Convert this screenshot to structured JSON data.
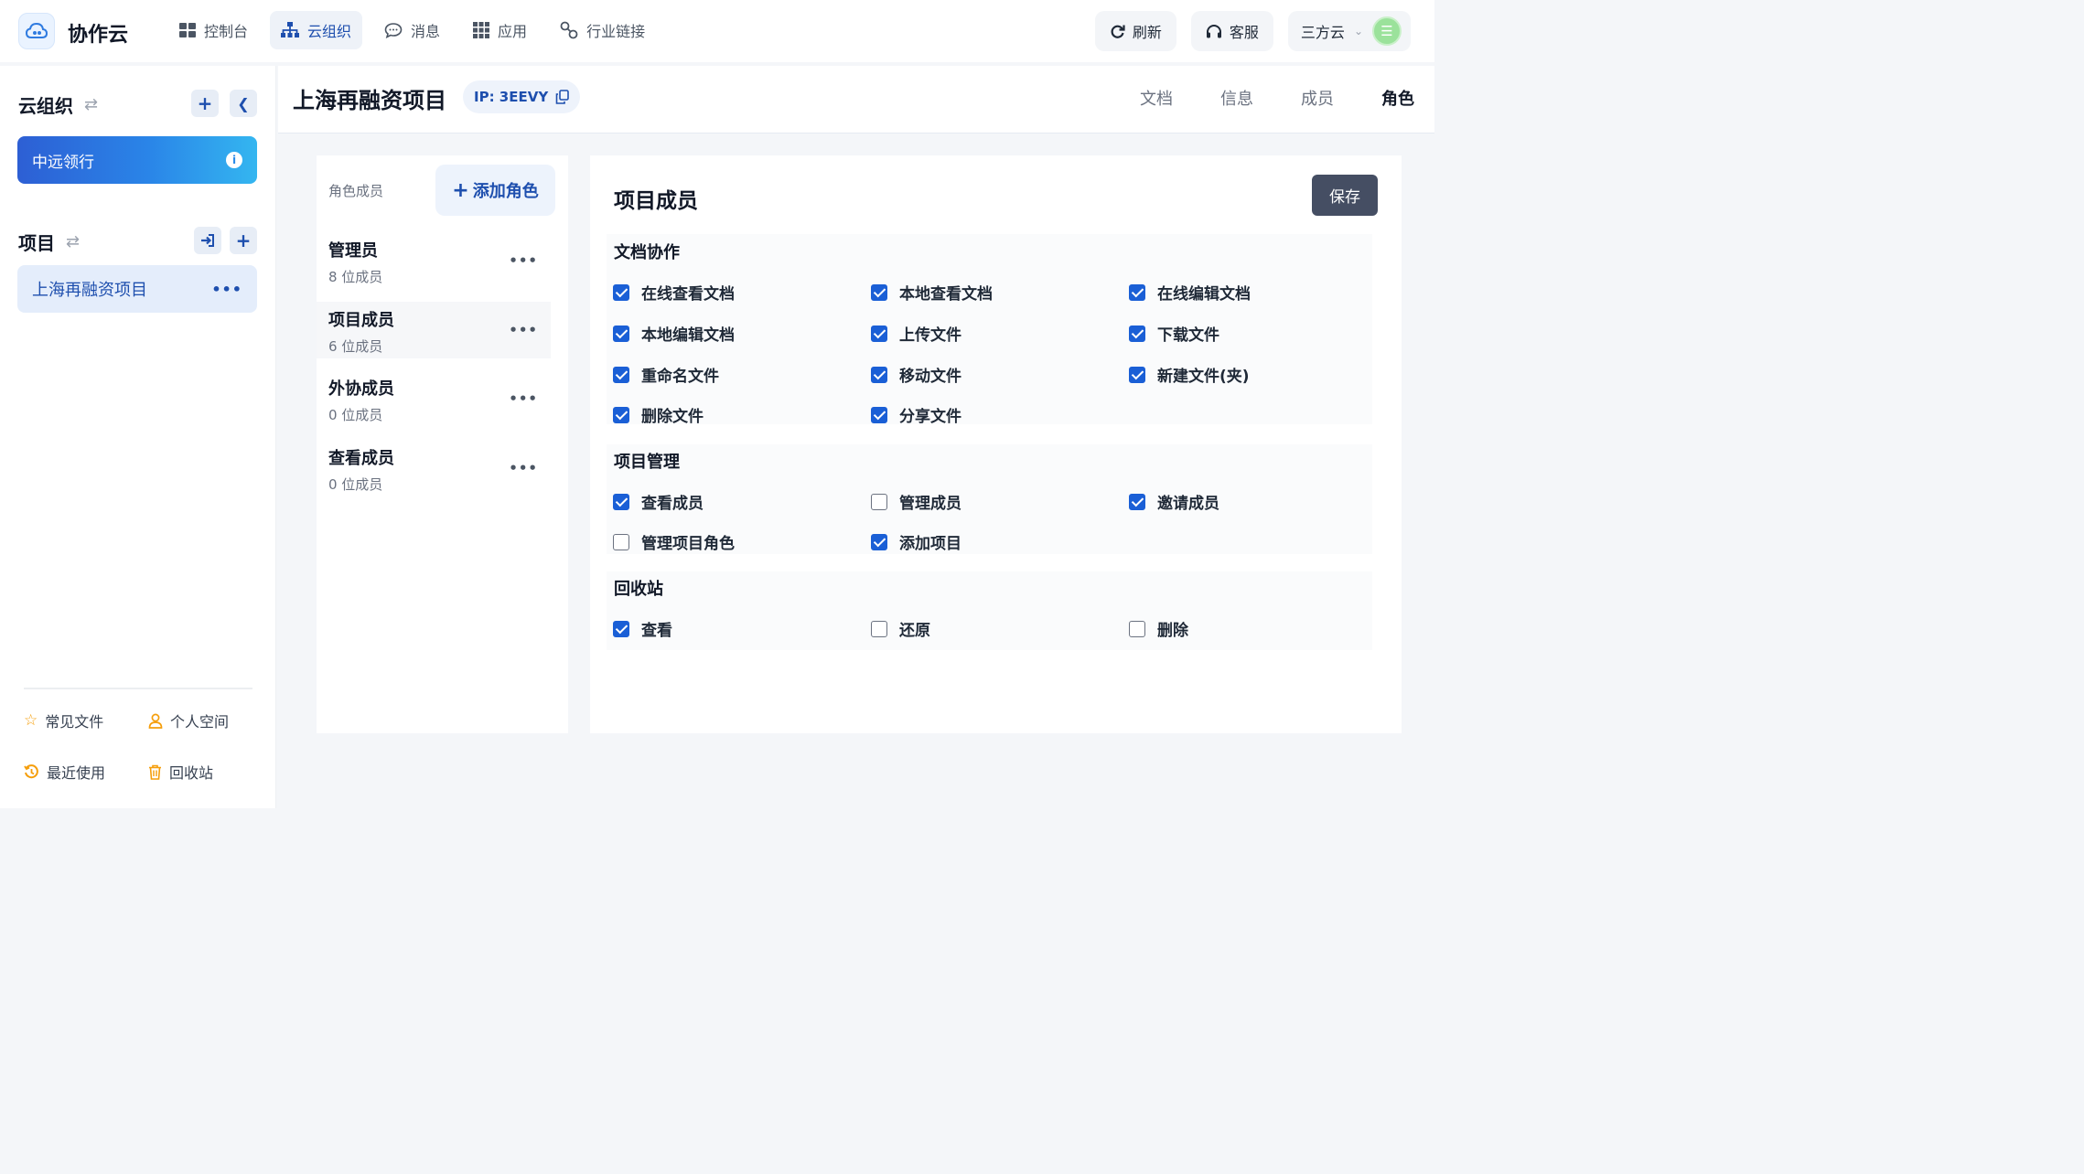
{
  "app": {
    "title": "协作云"
  },
  "nav": {
    "items": [
      {
        "label": "控制台",
        "icon": "dashboard-grid-icon"
      },
      {
        "label": "云组织",
        "icon": "org-tree-icon",
        "active": true
      },
      {
        "label": "消息",
        "icon": "chat-bubble-icon"
      },
      {
        "label": "应用",
        "icon": "apps-grid-icon"
      },
      {
        "label": "行业链接",
        "icon": "link-icon"
      }
    ]
  },
  "topbar": {
    "refresh": "刷新",
    "support": "客服",
    "account": "三方云",
    "avatar_glyph": "☰"
  },
  "sidebar": {
    "org_heading": "云组织",
    "org_name": "中远领行",
    "project_heading": "项目",
    "project_name": "上海再融资项目",
    "quick_links": [
      "常见文件",
      "个人空间",
      "最近使用",
      "回收站"
    ]
  },
  "project": {
    "title": "上海再融资项目",
    "ip_label": "IP: 3EEVY",
    "tabs": [
      "文档",
      "信息",
      "成员",
      "角色"
    ],
    "active_tab": "角色"
  },
  "roles": {
    "label": "角色成员",
    "add_button": "添加角色",
    "items": [
      {
        "name": "管理员",
        "count": "8 位成员"
      },
      {
        "name": "项目成员",
        "count": "6 位成员"
      },
      {
        "name": "外协成员",
        "count": "0 位成员"
      },
      {
        "name": "查看成员",
        "count": "0 位成员"
      }
    ]
  },
  "permissions": {
    "title": "项目成员",
    "save_button": "保存",
    "groups": [
      {
        "title": "文档协作",
        "items": [
          {
            "label": "在线查看文档",
            "checked": true
          },
          {
            "label": "本地查看文档",
            "checked": true
          },
          {
            "label": "在线编辑文档",
            "checked": true
          },
          {
            "label": "本地编辑文档",
            "checked": true
          },
          {
            "label": "上传文件",
            "checked": true
          },
          {
            "label": "下载文件",
            "checked": true
          },
          {
            "label": "重命名文件",
            "checked": true
          },
          {
            "label": "移动文件",
            "checked": true
          },
          {
            "label": "新建文件(夹)",
            "checked": true
          },
          {
            "label": "删除文件",
            "checked": true
          },
          {
            "label": "分享文件",
            "checked": true
          }
        ]
      },
      {
        "title": "项目管理",
        "items": [
          {
            "label": "查看成员",
            "checked": true
          },
          {
            "label": "管理成员",
            "checked": false
          },
          {
            "label": "邀请成员",
            "checked": true
          },
          {
            "label": "管理项目角色",
            "checked": false
          },
          {
            "label": "添加项目",
            "checked": true
          }
        ]
      },
      {
        "title": "回收站",
        "items": [
          {
            "label": "查看",
            "checked": true
          },
          {
            "label": "还原",
            "checked": false
          },
          {
            "label": "删除",
            "checked": false
          }
        ]
      }
    ]
  }
}
